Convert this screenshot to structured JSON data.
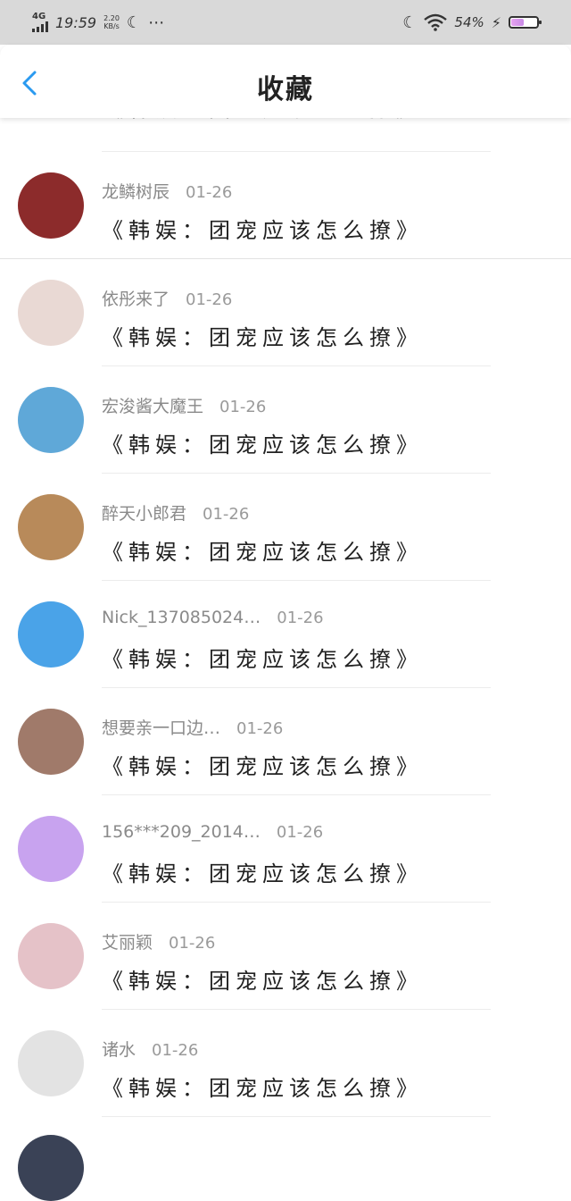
{
  "status_bar": {
    "network": "4G",
    "time": "19:59",
    "speed_value": "2.20",
    "speed_unit": "KB/s",
    "battery_percent": "54%",
    "battery_level": 0.54,
    "icons": [
      "signal-icon",
      "moon-icon",
      "more-dots-icon",
      "wifi-icon",
      "charging-icon",
      "battery-icon"
    ]
  },
  "header": {
    "title": "收藏",
    "back_icon": "chevron-left-icon",
    "accent": "#2a9af0"
  },
  "list": {
    "partial_top_content": "《韩娱：团宠应该怎么撩》",
    "items": [
      {
        "name": "龙鳞树辰",
        "date": "01-26",
        "content": "《韩娱：团宠应该怎么撩》",
        "avatar_color": "#8c2b2b"
      },
      {
        "name": "依彤来了",
        "date": "01-26",
        "content": "《韩娱：团宠应该怎么撩》",
        "avatar_color": "#e9d9d4"
      },
      {
        "name": "宏浚酱大魔王",
        "date": "01-26",
        "content": "《韩娱：团宠应该怎么撩》",
        "avatar_color": "#5fa8d8"
      },
      {
        "name": "醉天小郎君",
        "date": "01-26",
        "content": "《韩娱：团宠应该怎么撩》",
        "avatar_color": "#b88a5a"
      },
      {
        "name": "Nick_137085024…",
        "date": "01-26",
        "content": "《韩娱：团宠应该怎么撩》",
        "avatar_color": "#4aa3e8"
      },
      {
        "name": "想要亲一口边…",
        "date": "01-26",
        "content": "《韩娱：团宠应该怎么撩》",
        "avatar_color": "#a07a6a"
      },
      {
        "name": "156***209_2014…",
        "date": "01-26",
        "content": "《韩娱：团宠应该怎么撩》",
        "avatar_color": "#c8a3ef"
      },
      {
        "name": "艾丽颖",
        "date": "01-26",
        "content": "《韩娱：团宠应该怎么撩》",
        "avatar_color": "#e5c2c8"
      },
      {
        "name": "诸水",
        "date": "01-26",
        "content": "《韩娱：团宠应该怎么撩》",
        "avatar_color": "#e3e3e3"
      }
    ]
  }
}
